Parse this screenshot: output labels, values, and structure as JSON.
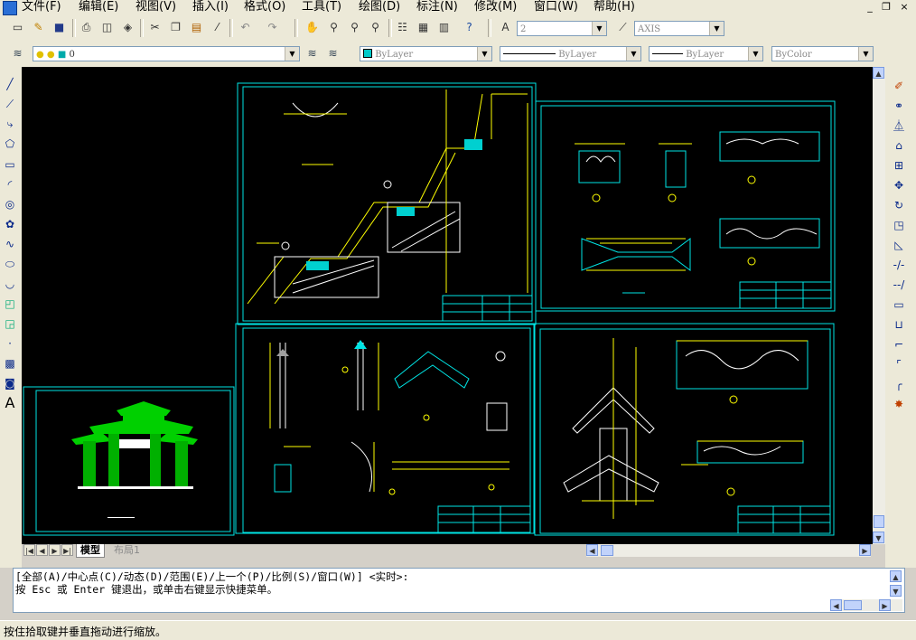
{
  "menu": {
    "items": [
      "文件(F)",
      "编辑(E)",
      "视图(V)",
      "插入(I)",
      "格式(O)",
      "工具(T)",
      "绘图(D)",
      "标注(N)",
      "修改(M)",
      "窗口(W)",
      "帮助(H)"
    ]
  },
  "window_controls": {
    "minimize": "_",
    "restore": "❐",
    "close": "×"
  },
  "standard_toolbar": {
    "icons": [
      "new-icon",
      "open-icon",
      "save-icon",
      "print-icon",
      "preview-icon",
      "publish-icon",
      "cut-icon",
      "copy-icon",
      "paste-icon",
      "matchprop-icon",
      "undo-icon",
      "redo-icon",
      "pan-icon",
      "zoom-realtime-icon",
      "zoom-window-icon",
      "zoom-previous-icon",
      "properties-icon",
      "designcenter-icon",
      "toolpalette-icon",
      "help-icon"
    ],
    "text_style_value": "2",
    "dim_style_value": "AXIS"
  },
  "layers_toolbar": {
    "layer_value": "0",
    "color_value": "ByLayer",
    "linetype_value": "ByLayer",
    "lineweight_value": "ByLayer",
    "plotstyle_value": "ByColor"
  },
  "draw_toolbar": {
    "icons": [
      "line-icon",
      "xline-icon",
      "polyline-icon",
      "polygon-icon",
      "rectangle-icon",
      "arc-icon",
      "circle-icon",
      "revcloud-icon",
      "spline-icon",
      "ellipse-icon",
      "ellipse-arc-icon",
      "insert-block-icon",
      "make-block-icon",
      "point-icon",
      "hatch-icon",
      "region-icon",
      "mtext-icon"
    ],
    "text_icon_glyph": "A"
  },
  "modify_toolbar": {
    "icons": [
      "erase-icon",
      "copy-object-icon",
      "mirror-icon",
      "offset-icon",
      "array-icon",
      "move-icon",
      "rotate-icon",
      "scale-icon",
      "stretch-icon",
      "trim-icon",
      "extend-icon",
      "break-at-point-icon",
      "break-icon",
      "join-icon",
      "chamfer-icon",
      "fillet-icon",
      "explode-icon"
    ]
  },
  "tabs": {
    "model": "模型",
    "layout1": "布局1"
  },
  "command": {
    "line1": "[全部(A)/中心点(C)/动态(D)/范围(E)/上一个(P)/比例(S)/窗口(W)] <实时>:",
    "line2": "按 Esc 或 Enter 键退出，或单击右键显示快捷菜单。"
  },
  "status": {
    "text": "按住拾取键并垂直拖动进行缩放。"
  },
  "colors": {
    "canvas": "#000000",
    "frame": "#00e5e5",
    "line_yellow": "#ffff00",
    "line_white": "#ffffff",
    "fill_green": "#00d000"
  }
}
